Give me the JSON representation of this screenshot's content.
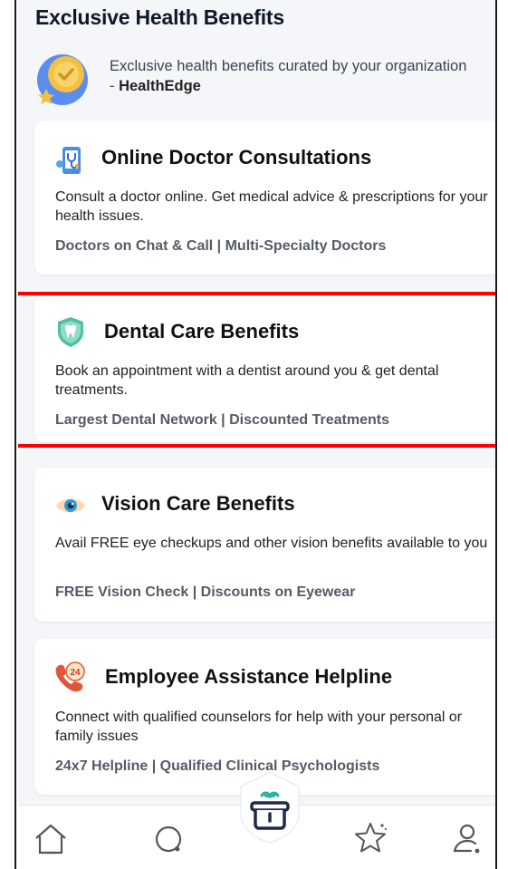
{
  "header": {
    "title": "Exclusive Health Benefits",
    "org_line": "Exclusive health benefits curated by your organization - ",
    "org_name": "HealthEdge"
  },
  "cards": [
    {
      "icon": "doctor-phone-icon",
      "title": "Online Doctor Consultations",
      "desc": "Consult a doctor online. Get medical advice & prescriptions for your health issues.",
      "tags": "Doctors on Chat & Call | Multi-Specialty Doctors"
    },
    {
      "icon": "tooth-shield-icon",
      "title": "Dental Care Benefits",
      "desc": "Book an appointment with a dentist around you & get dental treatments.",
      "tags": "Largest Dental Network | Discounted Treatments"
    },
    {
      "icon": "eye-icon",
      "title": "Vision Care Benefits",
      "desc": "Avail FREE eye checkups and other vision benefits available to you",
      "tags": "FREE Vision Check | Discounts on Eyewear"
    },
    {
      "icon": "helpline-24-icon",
      "title": "Employee Assistance Helpline",
      "desc": "Connect with qualified counselors for help with your personal or family issues",
      "tags": "24x7 Helpline | Qualified Clinical Psychologists"
    }
  ],
  "nav": {
    "items": [
      "home-icon",
      "chat-icon",
      "benefits-gift-icon",
      "star-icon",
      "profile-icon"
    ]
  },
  "colors": {
    "highlight": "#ff0000",
    "background": "#f4f6f9",
    "accent_teal": "#2bb3a6",
    "nav_dark": "#1e2a4a"
  }
}
